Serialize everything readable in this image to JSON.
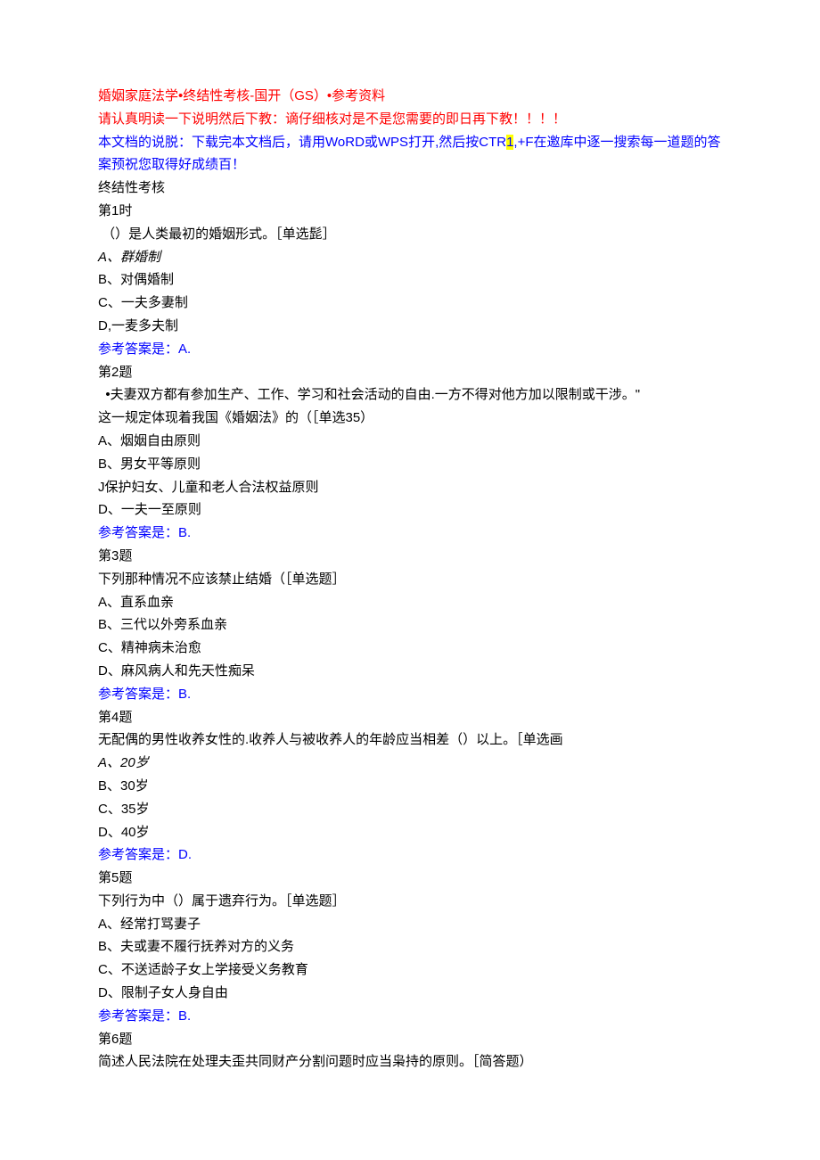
{
  "header": {
    "title_line": "婚姻家庭法学•终结性考核-国开（GS）•参考资料",
    "notice_line": "请认真明读一下说明然后下教：谪仔细核对是不是您需要的即日再下教！！！！",
    "instruction_prefix": "本文档的说脱：下载完本文档后，请用WoRD或WPS打开,然后按CTR",
    "instruction_highlight": "1",
    "instruction_suffix": ",+F在邀库中逐一搜索每一道题的答案预祝您取得好成绩百！"
  },
  "section_title": "终结性考核",
  "questions": [
    {
      "number": "第1时",
      "stem": " （）是人类最初的婚姻形式。［单选髭］",
      "options": [
        "A、群婚制",
        "B、对偶婚制",
        "C、一夫多妻制",
        "D,一麦多夫制"
      ],
      "answer": "参考答案是：A."
    },
    {
      "number": "第2题",
      "stem_line1": "  •夫妻双方都有参加生产、工作、学习和社会活动的自由.一方不得对他方加以限制或干涉。\"",
      "stem_line2": "这一规定体现着我国《婚姻法》的（［单选35）",
      "options": [
        "A、烟姻自由原则",
        "B、男女平等原则",
        "J保护妇女、儿童和老人合法权益原则",
        "D、一夫一至原则"
      ],
      "answer": "参考答案是：B."
    },
    {
      "number": "第3题",
      "stem": "下列那种情况不应该禁止结婚（［单选题］",
      "options": [
        "A、直系血亲",
        "B、三代以外旁系血亲",
        "C、精神病未治愈",
        "D、麻风病人和先天性痴呆"
      ],
      "answer": "参考答案是：B."
    },
    {
      "number": "第4题",
      "stem": "无配偶的男性收养女性的.收养人与被收养人的年龄应当相差（）以上。［单选画",
      "options": [
        "A、20岁",
        "B、30岁",
        "C、35岁",
        "D、40岁"
      ],
      "answer": "参考答案是：D."
    },
    {
      "number": "第5题",
      "stem": "下列行为中（）属于遗弃行为。［单选题］",
      "options": [
        "A、经常打骂妻子",
        "B、夫或妻不履行抚养对方的义务",
        "C、不送适龄子女上学接受义务教育",
        "D、限制子女人身自由"
      ],
      "answer": "参考答案是：B."
    },
    {
      "number": "第6题",
      "stem": "简述人民法院在处理夫歪共同财产分割问题时应当枭持的原则。［简答题）",
      "options": [],
      "answer": ""
    }
  ]
}
